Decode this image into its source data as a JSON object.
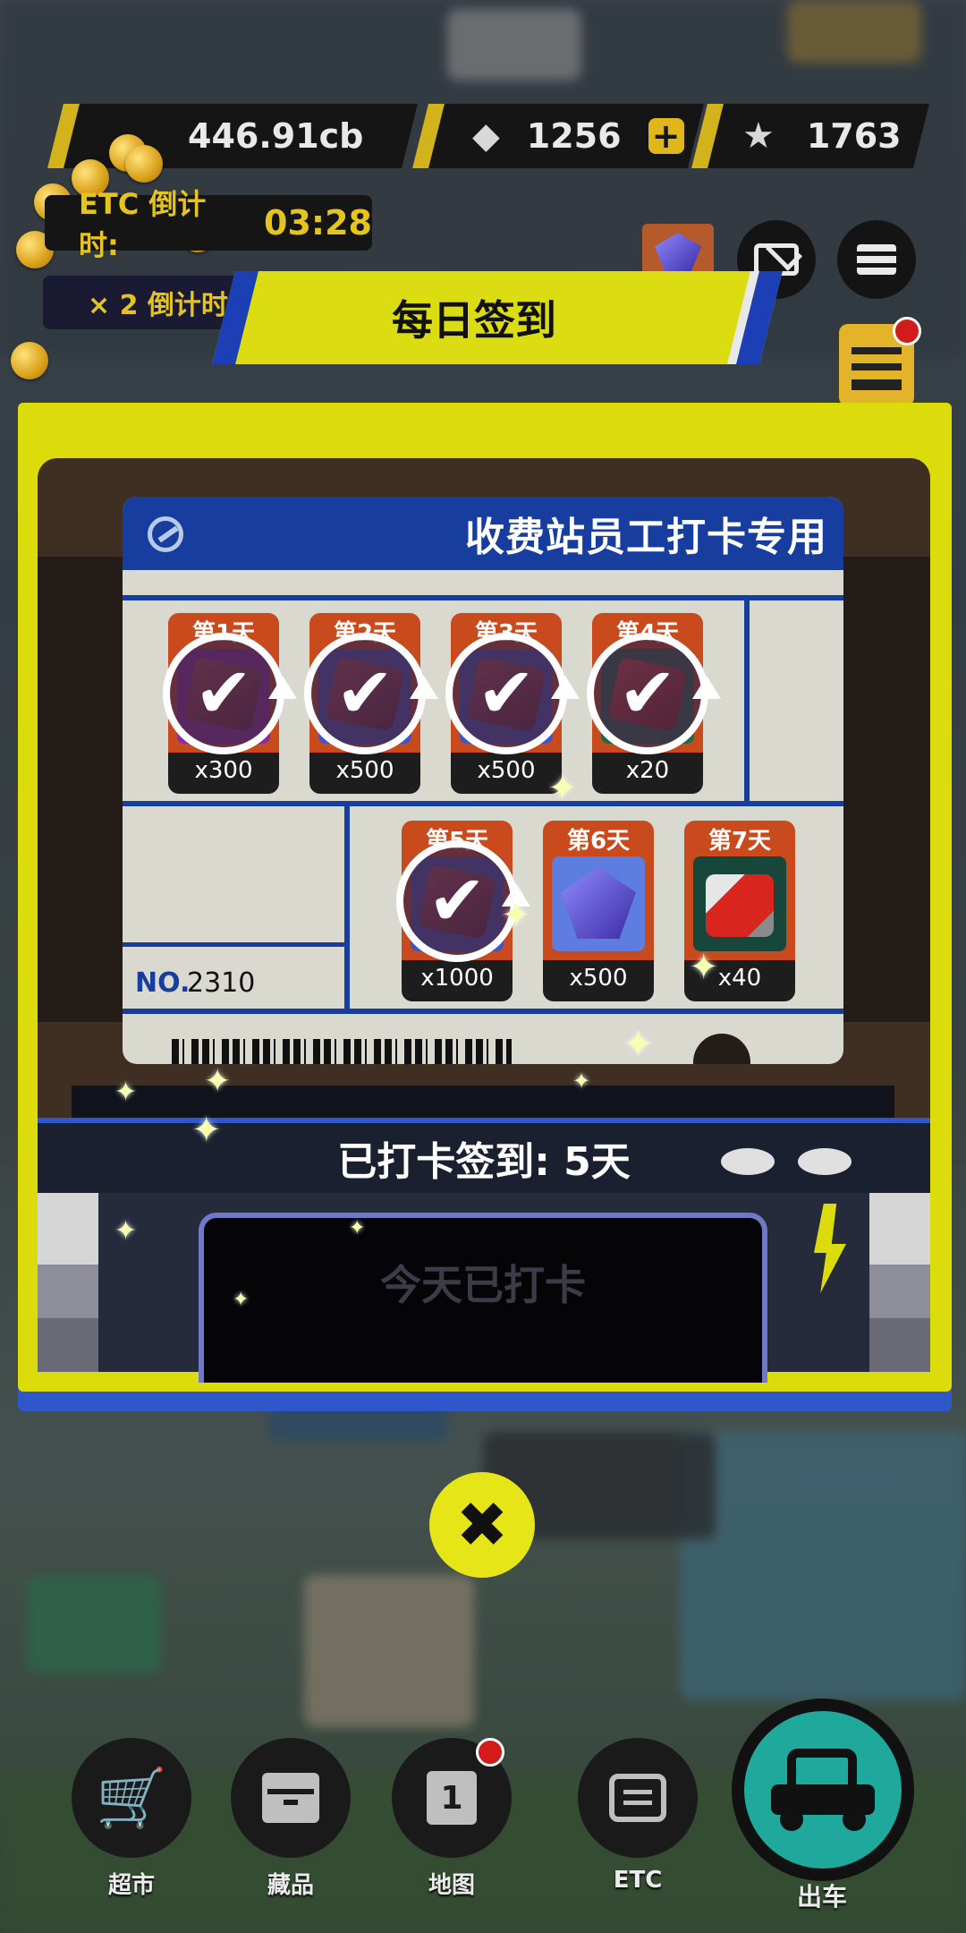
{
  "hud": {
    "currency": "446.91cb",
    "gems": "1256",
    "stars": "1763",
    "etc_timer_label": "ETC 倒计时:",
    "etc_timer_value": "03:28",
    "multiplier_label": "× 2 倒计时"
  },
  "dialog": {
    "title": "每日签到",
    "card_title": "收费站员工打卡专用",
    "rewards": [
      {
        "day": "第1天",
        "amount": "x300",
        "claimed": true
      },
      {
        "day": "第2天",
        "amount": "x500",
        "claimed": true
      },
      {
        "day": "第3天",
        "amount": "x500",
        "claimed": true
      },
      {
        "day": "第4天",
        "amount": "x20",
        "claimed": true
      },
      {
        "day": "第5天",
        "amount": "x1000",
        "claimed": true
      },
      {
        "day": "第6天",
        "amount": "x500",
        "claimed": false
      },
      {
        "day": "第7天",
        "amount": "x40",
        "claimed": false
      }
    ],
    "no_label": "NO.",
    "no_value": "2310",
    "checked_in": "已打卡签到: 5天",
    "button_text": "今天已打卡"
  },
  "nav": {
    "supermarket": "超市",
    "collection": "藏品",
    "map": "地图",
    "etc": "ETC",
    "drive": "出车"
  },
  "colors": {
    "accent_yellow": "#dcdc0c",
    "accent_blue": "#173d9e",
    "reward_orange": "#c84a1d",
    "drive_teal": "#1fa89c"
  }
}
